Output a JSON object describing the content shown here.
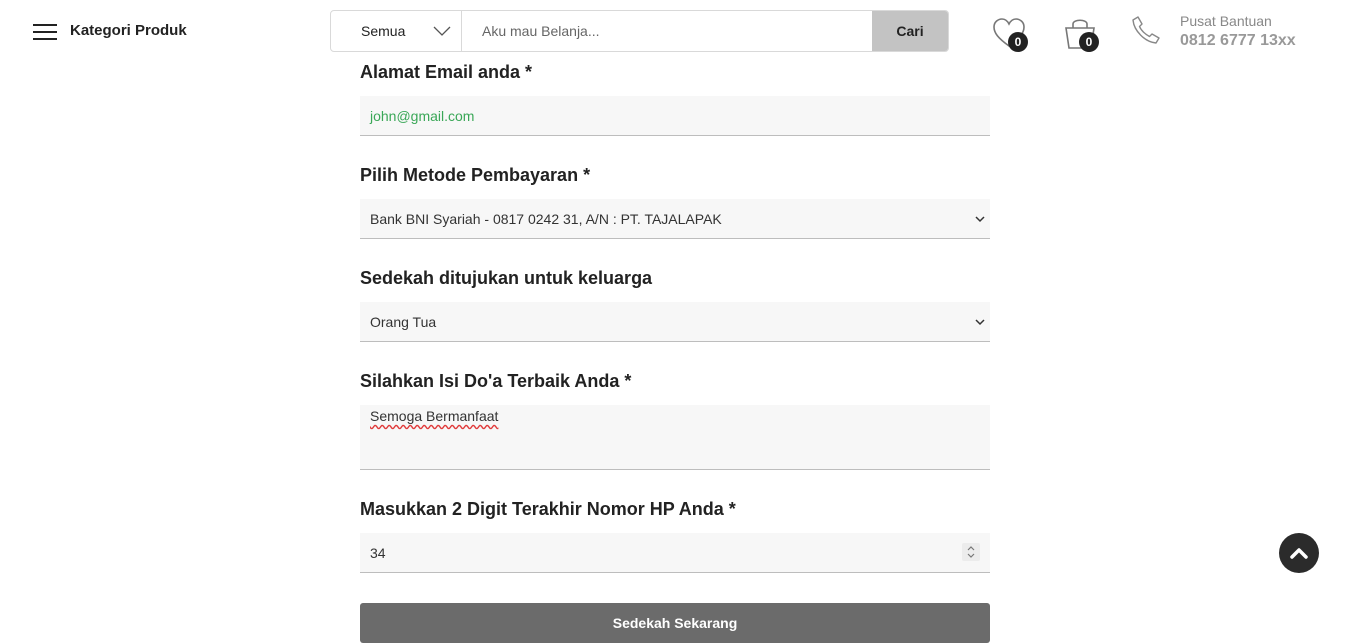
{
  "header": {
    "category_label": "Kategori Produk",
    "search": {
      "category_value": "Semua",
      "placeholder": "Aku mau Belanja...",
      "button_label": "Cari"
    },
    "wishlist_count": "0",
    "cart_count": "0",
    "help": {
      "title": "Pusat Bantuan",
      "phone": "0812 6777 13xx"
    },
    "icons": [
      "menu-icon",
      "chevron-down-icon",
      "heart-icon",
      "shopping-bag-icon",
      "phone-icon"
    ]
  },
  "form": {
    "email": {
      "label": "Alamat Email anda *",
      "value": "john@gmail.com"
    },
    "payment": {
      "label": "Pilih Metode Pembayaran *",
      "selected": "Bank BNI Syariah - 0817 0242 31, A/N : PT. TAJALAPAK"
    },
    "family": {
      "label": "Sedekah ditujukan untuk keluarga",
      "selected": "Orang Tua"
    },
    "prayer": {
      "label": "Silahkan Isi Do'a Terbaik Anda *",
      "value": "Semoga Bermanfaat"
    },
    "phone_digits": {
      "label": "Masukkan 2 Digit Terakhir Nomor HP Anda *",
      "value": "34"
    },
    "submit_label": "Sedekah Sekarang"
  },
  "colors": {
    "email_text": "#3aa757",
    "submit_bg": "#6b6b6b",
    "search_button_bg": "#c3c3c3",
    "field_bg": "#f7f7f7"
  }
}
